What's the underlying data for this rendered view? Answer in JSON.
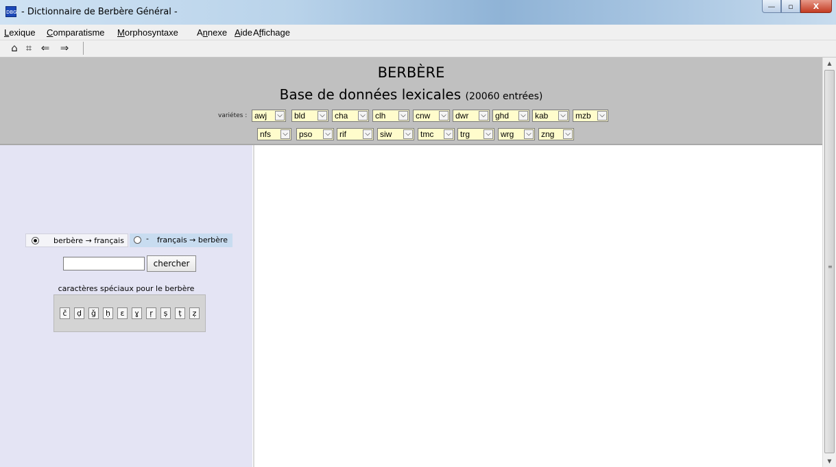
{
  "window": {
    "title": "- Dictionnaire de Berbère Général -",
    "icon_text": "DBG",
    "controls": {
      "minimize": "—",
      "maximize": "▫",
      "close": "X"
    }
  },
  "menu": [
    {
      "label": "Lexique",
      "accel": "L"
    },
    {
      "label": "Comparatisme",
      "accel": "C"
    },
    {
      "label": "Morphosyntaxe",
      "accel": "M"
    },
    {
      "label": "Annexe",
      "accel": "n"
    },
    {
      "label": "Aide",
      "accel": "A"
    },
    {
      "label": "Affichage",
      "accel": "f"
    }
  ],
  "toolbar": {
    "home": "⌂",
    "grid": "⌗",
    "back": "⇐",
    "forward": "⇒"
  },
  "header": {
    "title": "BERBÈRE",
    "subtitle": "Base de données lexicales",
    "count": "(20060 entrées)",
    "varietes_label": "variétes :",
    "varieties_row1": [
      "awj",
      "bld",
      "cha",
      "clh",
      "cnw",
      "dwr",
      "ghd",
      "kab",
      "mzb"
    ],
    "varieties_row2": [
      "nfs",
      "pso",
      "rif",
      "siw",
      "tmc",
      "trg",
      "wrg",
      "zng"
    ]
  },
  "search": {
    "option1": "berbère → français",
    "option2": "français → berbère",
    "option2_prefix": "-",
    "selected": "option1",
    "input_value": "",
    "button": "chercher"
  },
  "special_chars": {
    "label": "caractères spéciaux pour le berbère",
    "chars": [
      "č",
      "ḍ",
      "ǧ",
      "ḥ",
      "ɛ",
      "ɣ",
      "ṛ",
      "ṣ",
      "ṭ",
      "ẓ"
    ]
  },
  "colors": {
    "header_bg": "#c0c0c0",
    "left_pane_bg": "#e4e4f4",
    "dropdown_bg": "#fffccc",
    "option2_bg": "#c8dcf0"
  }
}
